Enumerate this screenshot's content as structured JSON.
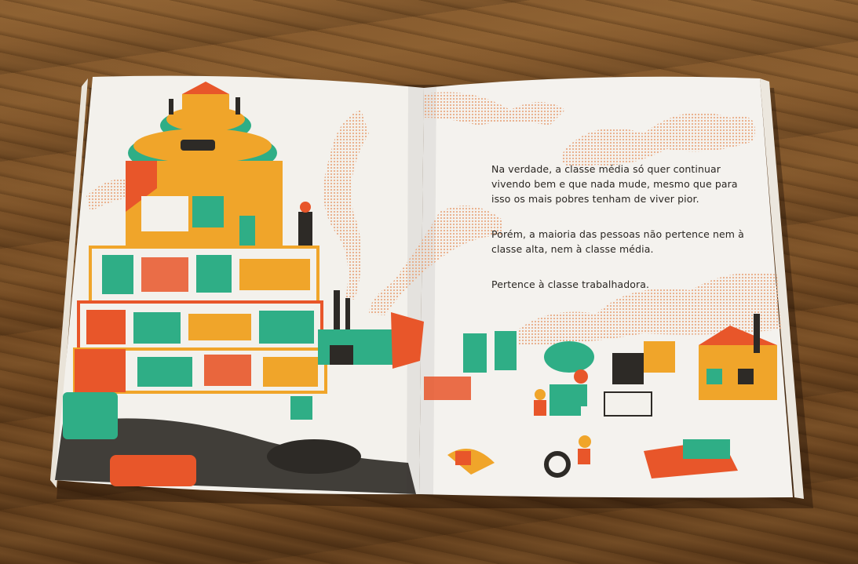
{
  "book": {
    "right_page_text": {
      "paragraph_1": "Na verdade, a classe média só quer continuar vivendo bem e que nada mude, mesmo que para isso os mais pobres tenham de viver pior.",
      "paragraph_2": "Porém, a maioria das pessoas não pertence nem à classe alta, nem à classe média.",
      "paragraph_3": "Pertence à classe trabalhadora."
    }
  },
  "colors": {
    "wood": "#7a5228",
    "paper": "#f3f1ec",
    "green": "#2fae86",
    "orange": "#e8562a",
    "yellow": "#f0a52a",
    "peach": "#f2c59a",
    "ink": "#2d2a26"
  }
}
